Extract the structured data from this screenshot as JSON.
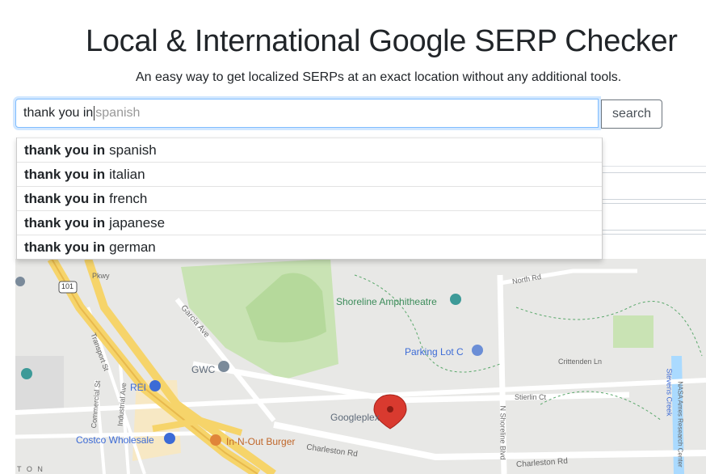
{
  "header": {
    "title": "Local & International Google SERP Checker",
    "subtitle": "An easy way to get localized SERPs at an exact location without any additional tools."
  },
  "search": {
    "typed": "thank you in",
    "hint": "spanish",
    "button_label": "search"
  },
  "suggestions": [
    {
      "prefix": "thank you in",
      "rest": "spanish"
    },
    {
      "prefix": "thank you in",
      "rest": "italian"
    },
    {
      "prefix": "thank you in",
      "rest": "french"
    },
    {
      "prefix": "thank you in",
      "rest": "japanese"
    },
    {
      "prefix": "thank you in",
      "rest": "german"
    }
  ],
  "map": {
    "labels": {
      "shoreline": "Shoreline Amphitheatre",
      "parking": "Parking Lot C",
      "gwc": "GWC",
      "rei": "REI",
      "costco": "Costco Wholesale",
      "innout": "In-N-Out Burger",
      "googleplex": "Googleplex",
      "charleston1": "Charleston Rd",
      "charleston2": "Charleston Rd",
      "garcia": "Garcia Ave",
      "transport": "Transport St",
      "industrial": "Industrial Ave",
      "commercial": "Commercial St",
      "crittenden": "Crittenden Ln",
      "stierlin": "Stierlin Ct",
      "northrd": "North Rd",
      "nshoreline": "N Shoreline Blvd",
      "stevens": "Stevens Creek",
      "nasa": "NASA Ames Research Center",
      "hwy101": "101",
      "pkwy": "Pkwy",
      "ton": "T O N"
    },
    "colors": {
      "park": "#c9e3b4",
      "highway": "#f6d46a",
      "water": "#aadaff",
      "marker": "#d93a2f"
    }
  }
}
